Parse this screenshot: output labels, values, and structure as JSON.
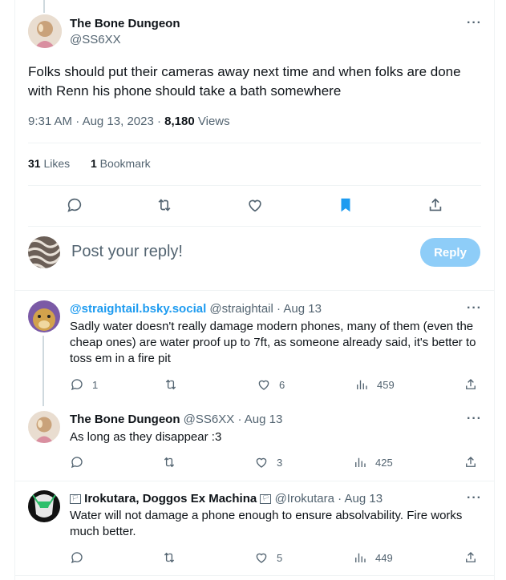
{
  "main_tweet": {
    "author_name": "The Bone Dungeon",
    "author_handle": "@SS6XX",
    "text": "Folks should put their cameras away next time and when folks are done with Renn his phone should take a bath somewhere",
    "time": "9:31 AM",
    "date": "Aug 13, 2023",
    "views_count": "8,180",
    "views_label": "Views",
    "likes_count": "31",
    "likes_label": "Likes",
    "bookmarks_count": "1",
    "bookmarks_label": "Bookmark",
    "more_label": "···"
  },
  "composer": {
    "placeholder": "Post your reply!",
    "reply_button": "Reply"
  },
  "replies": [
    {
      "name": "@straightail.bsky.social",
      "handle": "@straightail",
      "date": "Aug 13",
      "text": "Sadly water doesn't really damage modern phones, many of them (even the cheap ones) are water proof up to 7ft, as someone already said, it's better to toss em in a fire pit",
      "replies": "1",
      "retweets": "",
      "likes": "6",
      "views": "459"
    },
    {
      "name": "The Bone Dungeon",
      "handle": "@SS6XX",
      "date": "Aug 13",
      "text": "As long as they disappear :3",
      "replies": "",
      "retweets": "",
      "likes": "3",
      "views": "425"
    },
    {
      "name": "Irokutara, Doggos Ex Machina",
      "flag_left": "🏳",
      "flag_right": "🏳",
      "handle": "@Irokutara",
      "date": "Aug 13",
      "text": "Water will not damage a phone enough to ensure absolvability. Fire works much better.",
      "replies": "",
      "retweets": "",
      "likes": "5",
      "views": "449"
    }
  ],
  "colors": {
    "accent": "#1d9bf0",
    "reply_button_disabled": "#8ecdf8",
    "muted_text": "#536471",
    "divider": "#eff3f4"
  },
  "separator": "·",
  "more_label": "···"
}
